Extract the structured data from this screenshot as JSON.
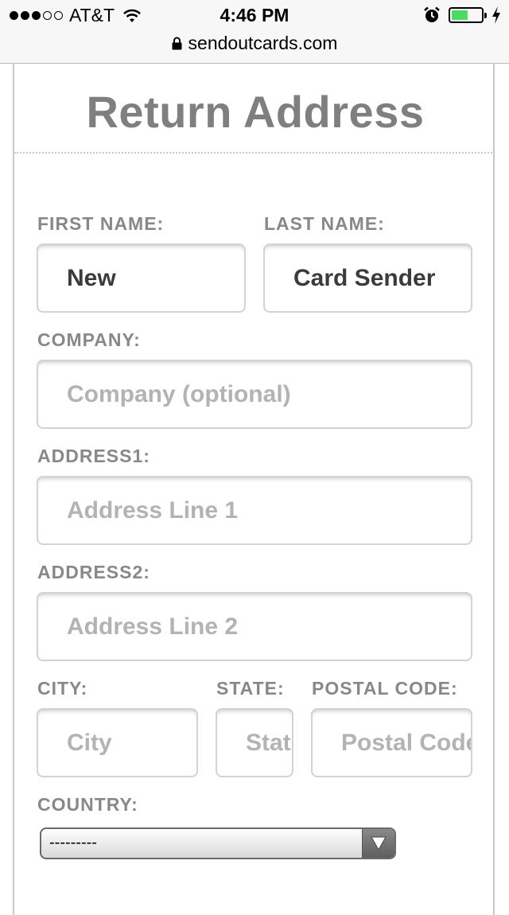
{
  "status_bar": {
    "signal_dots_filled": 3,
    "signal_dots_total": 5,
    "carrier": "AT&T",
    "time": "4:46 PM",
    "battery_level": 0.55,
    "battery_color": "#4cd964"
  },
  "browser": {
    "url": "sendoutcards.com"
  },
  "form": {
    "title": "Return Address",
    "first_name": {
      "label": "FIRST NAME:",
      "value": "New"
    },
    "last_name": {
      "label": "LAST NAME:",
      "value": "Card Sender"
    },
    "company": {
      "label": "COMPANY:",
      "placeholder": "Company (optional)"
    },
    "address1": {
      "label": "ADDRESS1:",
      "placeholder": "Address Line 1"
    },
    "address2": {
      "label": "ADDRESS2:",
      "placeholder": "Address Line 2"
    },
    "city": {
      "label": "CITY:",
      "placeholder": "City"
    },
    "state": {
      "label": "STATE:",
      "placeholder": "State"
    },
    "postal_code": {
      "label": "POSTAL CODE:",
      "placeholder": "Postal Code"
    },
    "country": {
      "label": "COUNTRY:",
      "selected": "---------"
    }
  }
}
